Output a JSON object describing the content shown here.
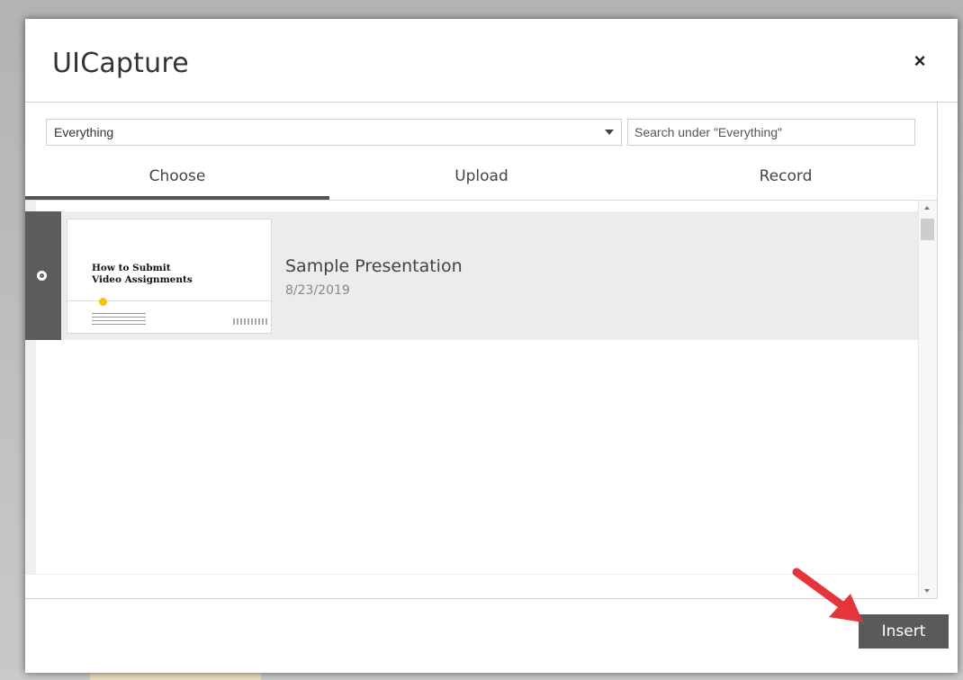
{
  "dialog": {
    "title": "UICapture",
    "close_glyph": "×",
    "close_icon": "close-icon"
  },
  "filter": {
    "selected": "Everything",
    "search_placeholder": "Search under \"Everything\""
  },
  "tabs": [
    {
      "label": "Choose",
      "active": true
    },
    {
      "label": "Upload",
      "active": false
    },
    {
      "label": "Record",
      "active": false
    }
  ],
  "items": [
    {
      "name": "Sample Presentation",
      "date": "8/23/2019",
      "selected": true,
      "thumbnail": {
        "title": "How to Submit\nVideo Assignments"
      }
    }
  ],
  "footer": {
    "insert_label": "Insert"
  },
  "colors": {
    "accent": "#5a5a5a",
    "annotation_arrow": "#e5343a",
    "selected_row": "#ececec"
  }
}
